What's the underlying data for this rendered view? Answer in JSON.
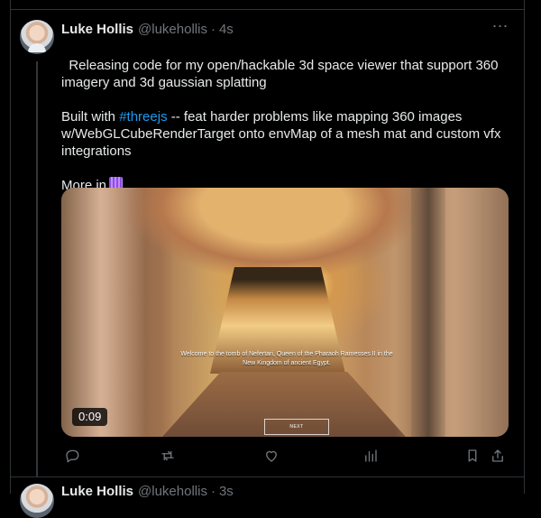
{
  "tweet": {
    "author": {
      "display_name": "Luke Hollis",
      "handle": "@lukehollis",
      "timestamp": "4s"
    },
    "text": {
      "line1": "Releasing code for my open/hackable 3d space viewer that support 360 imagery and 3d gaussian splatting",
      "built_prefix": "Built with ",
      "hashtag": "#threejs",
      "built_suffix": " -- feat harder problems like mapping 360 images w/WebGLCubeRenderTarget onto envMap of a mesh mat and custom vfx integrations",
      "more_prefix": "More in"
    },
    "media": {
      "duration": "0:09",
      "caption": "Welcome to the tomb of Nefertari, Queen of the Pharaoh Ramesses II in the New Kingdom of ancient Egypt.",
      "next_label": "NEXT"
    },
    "actions": [
      {
        "name": "reply",
        "icon": "reply-icon"
      },
      {
        "name": "repost",
        "icon": "repost-icon"
      },
      {
        "name": "like",
        "icon": "heart-icon"
      },
      {
        "name": "views",
        "icon": "analytics-icon"
      },
      {
        "name": "bookmark",
        "icon": "bookmark-icon"
      },
      {
        "name": "share",
        "icon": "share-icon"
      }
    ],
    "more_options_label": "⋯"
  },
  "next_tweet": {
    "display_name": "Luke Hollis",
    "handle": "@lukehollis",
    "timestamp": "3s"
  },
  "colors": {
    "background": "#000000",
    "text": "#e7e9ea",
    "muted": "#71767b",
    "link": "#1d9bf0",
    "border": "#2f3336"
  }
}
